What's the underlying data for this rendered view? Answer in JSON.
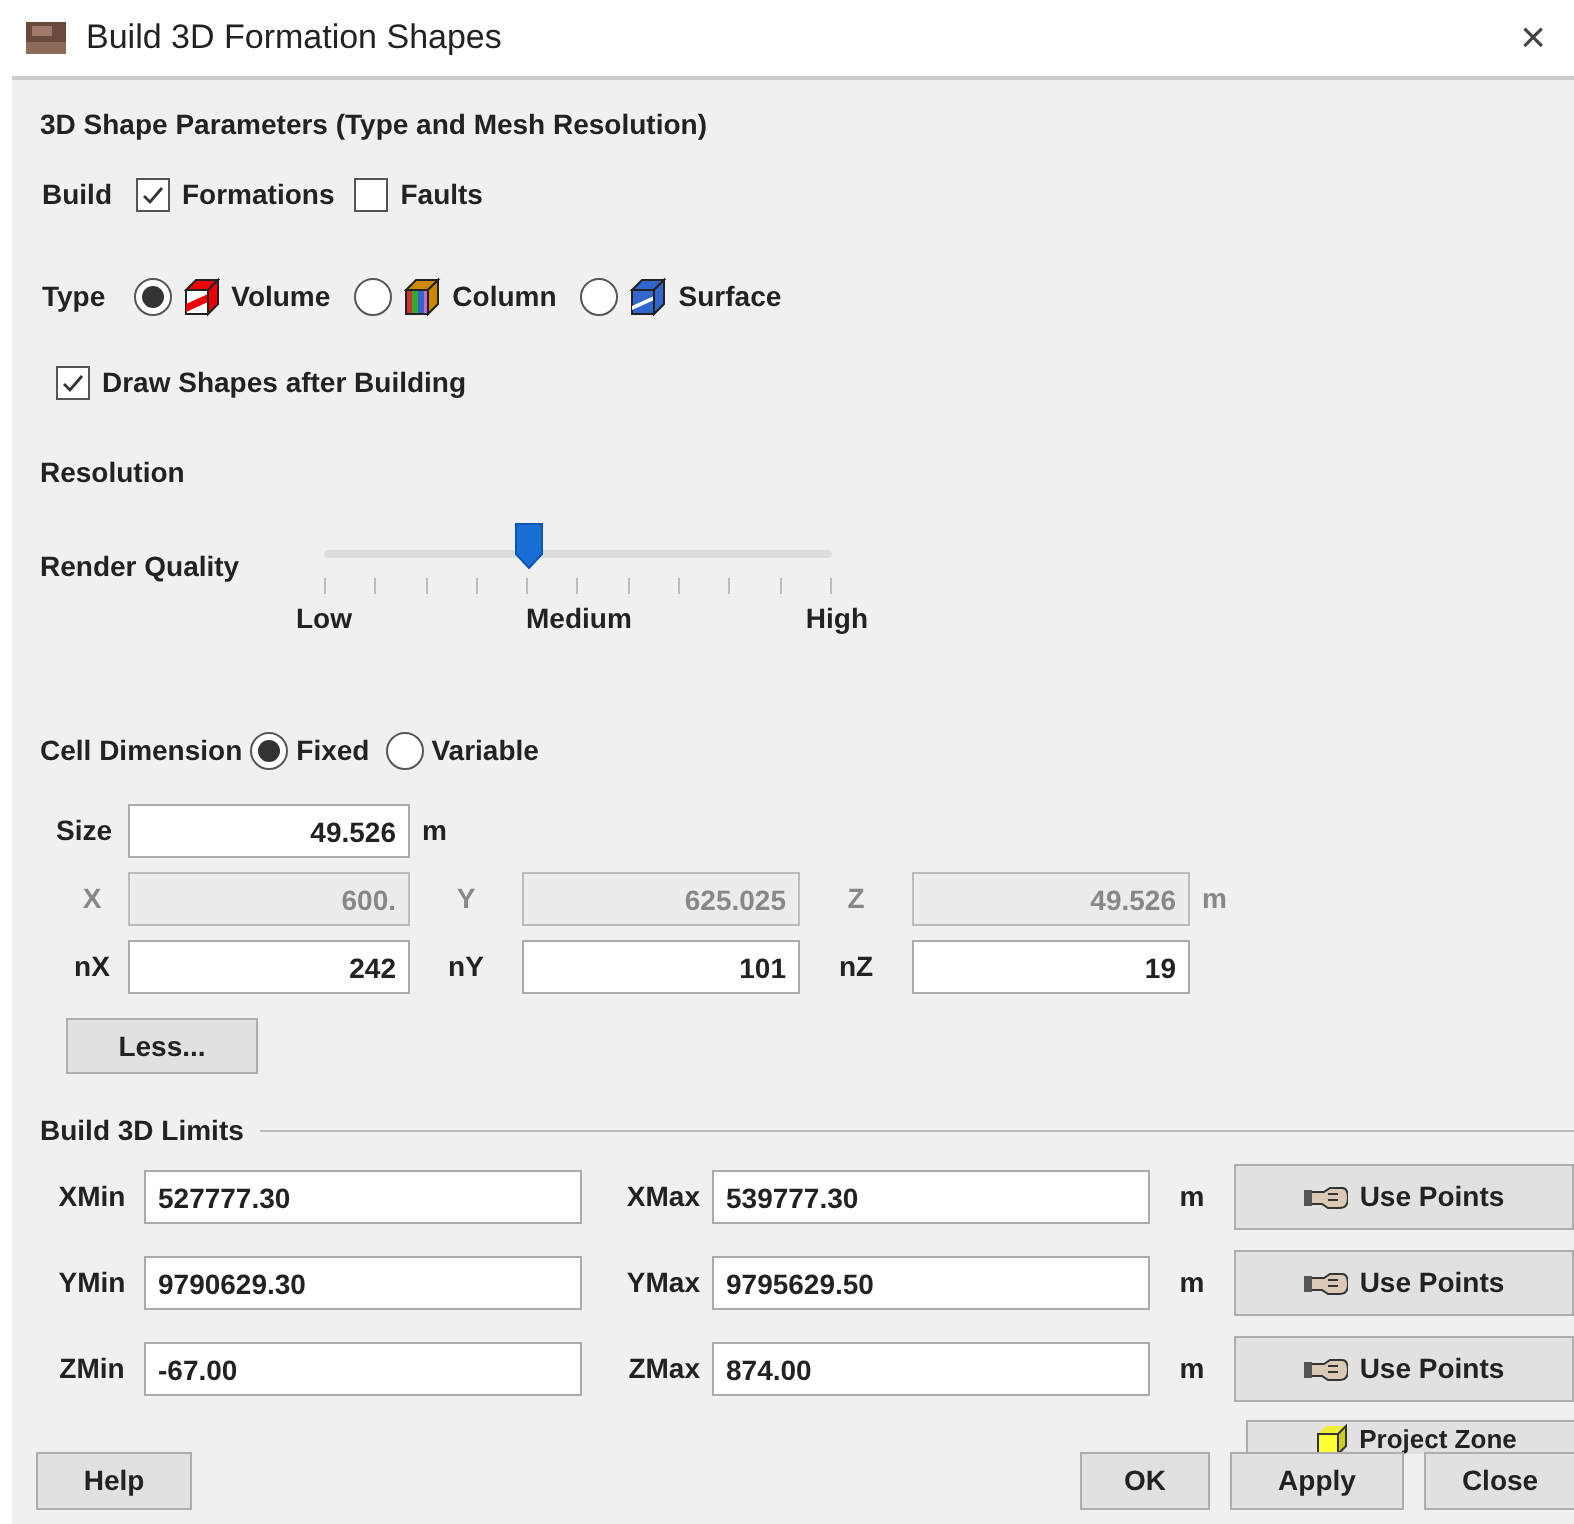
{
  "window": {
    "title": "Build 3D Formation Shapes",
    "close": "×"
  },
  "section_title": "3D Shape Parameters (Type and Mesh Resolution)",
  "build": {
    "label": "Build",
    "options": [
      {
        "label": "Formations",
        "checked": true
      },
      {
        "label": "Faults",
        "checked": false
      }
    ]
  },
  "type": {
    "label": "Type",
    "options": [
      {
        "label": "Volume",
        "selected": true,
        "kind": "volume"
      },
      {
        "label": "Column",
        "selected": false,
        "kind": "column"
      },
      {
        "label": "Surface",
        "selected": false,
        "kind": "surface"
      }
    ]
  },
  "draw_shapes": {
    "label": "Draw Shapes after Building",
    "checked": true
  },
  "resolution": {
    "label": "Resolution",
    "slider_label": "Render Quality",
    "level": 0.4,
    "tick_labels": [
      "Low",
      "Medium",
      "High"
    ]
  },
  "cell_dimension": {
    "label": "Cell Dimension",
    "options": [
      {
        "label": "Fixed",
        "selected": true
      },
      {
        "label": "Variable",
        "selected": false
      }
    ]
  },
  "size": {
    "label": "Size",
    "value": "49.526",
    "unit": "m"
  },
  "spacing": {
    "disabled": true,
    "unit": "m",
    "fields": [
      {
        "label": "X",
        "value": "600."
      },
      {
        "label": "Y",
        "value": "625.025"
      },
      {
        "label": "Z",
        "value": "49.526"
      }
    ]
  },
  "counts": {
    "fields": [
      {
        "label": "nX",
        "value": "242"
      },
      {
        "label": "nY",
        "value": "101"
      },
      {
        "label": "nZ",
        "value": "19"
      }
    ]
  },
  "less_button": "Less...",
  "limits": {
    "title": "Build 3D Limits",
    "rows": [
      {
        "min_label": "XMin",
        "min_value": "527777.30",
        "max_label": "XMax",
        "max_value": "539777.30",
        "unit": "m",
        "button": "Use Points"
      },
      {
        "min_label": "YMin",
        "min_value": "9790629.30",
        "max_label": "YMax",
        "max_value": "9795629.50",
        "unit": "m",
        "button": "Use Points"
      },
      {
        "min_label": "ZMin",
        "min_value": "-67.00",
        "max_label": "ZMax",
        "max_value": "874.00",
        "unit": "m",
        "button": "Use Points"
      }
    ],
    "project_zone_button": "Project Zone"
  },
  "footer_buttons": [
    "Help",
    "OK",
    "Apply",
    "Close"
  ]
}
